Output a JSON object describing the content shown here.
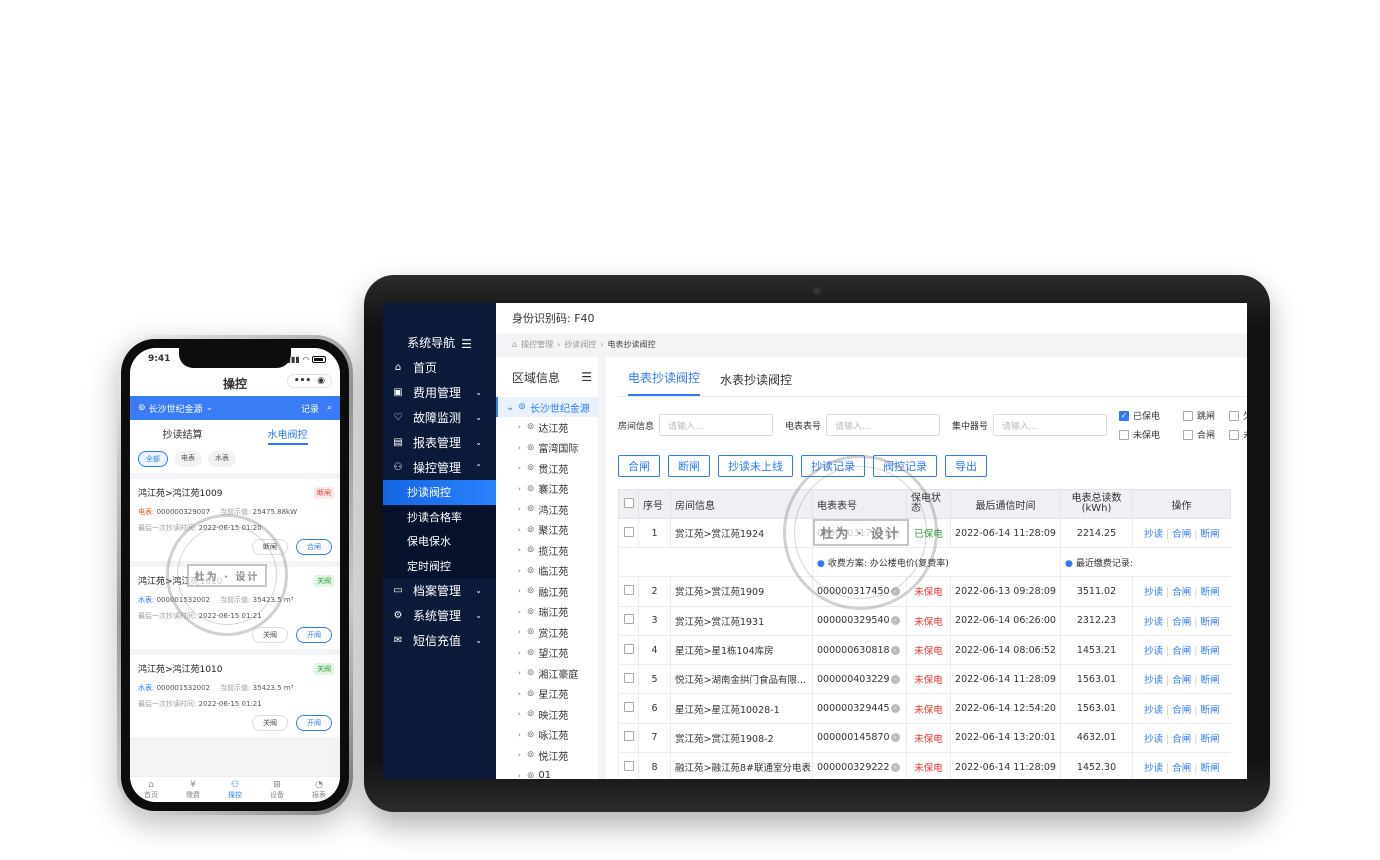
{
  "phone": {
    "time": "9:41",
    "title": "操控",
    "more_icon": "•••",
    "location": "长沙世纪金源",
    "record": "记录",
    "tabs": [
      "抄读结算",
      "水电阀控"
    ],
    "filters": [
      "全部",
      "电表",
      "水表"
    ],
    "cards": [
      {
        "title": "鸿江苑>鸿江苑1009",
        "badge": "断闸",
        "badge_color": "red",
        "type_label": "电表:",
        "type_color": "red",
        "number": "000000329007",
        "reading_label": "当前示值:",
        "reading": "25475.88kW",
        "last_label": "最后一次抄读时间:",
        "last_time": "2022-06-15 01:20",
        "btn1": "断闸",
        "btn2": "合闸"
      },
      {
        "title": "鸿江苑>鸿江苑1010",
        "badge": "关阀",
        "badge_color": "green",
        "type_label": "水表:",
        "type_color": "blue",
        "number": "000001532002",
        "reading_label": "当前示值:",
        "reading": "35423.5 m³",
        "last_label": "最后一次抄读时间:",
        "last_time": "2022-06-15 01:21",
        "btn1": "关阀",
        "btn2": "开阀"
      },
      {
        "title": "鸿江苑>鸿江苑1010",
        "badge": "关阀",
        "badge_color": "green",
        "type_label": "水表:",
        "type_color": "blue",
        "number": "000001532002",
        "reading_label": "当前示值:",
        "reading": "35423.5 m³",
        "last_label": "最后一次抄读时间:",
        "last_time": "2022-06-15 01:21",
        "btn1": "关阀",
        "btn2": "开阀"
      }
    ],
    "tabbar": [
      "首页",
      "缴费",
      "操控",
      "设备",
      "报表"
    ]
  },
  "desktop": {
    "nav_title": "系统导航",
    "menu": [
      {
        "label": "首页",
        "icon": "home-icon"
      },
      {
        "label": "费用管理",
        "icon": "wallet-icon"
      },
      {
        "label": "故障监测",
        "icon": "heart-icon"
      },
      {
        "label": "报表管理",
        "icon": "report-icon"
      },
      {
        "label": "操控管理",
        "icon": "user-control-icon"
      }
    ],
    "submenu": [
      "抄读阀控",
      "抄读合格率",
      "保电保水",
      "定时阀控"
    ],
    "menu_after": [
      {
        "label": "档案管理",
        "icon": "folder-icon"
      },
      {
        "label": "系统管理",
        "icon": "settings-icon"
      },
      {
        "label": "短信充值",
        "icon": "sms-icon"
      }
    ],
    "identity": "身份识别码: F40",
    "breadcrumb": [
      "操控管理",
      "抄读阀控",
      "电表抄读阀控"
    ],
    "tree_title": "区域信息",
    "tree_root": "长沙世纪金源",
    "tree_nodes": [
      "达江苑",
      "富湾国际",
      "贯江苑",
      "褰江苑",
      "鸿江苑",
      "聚江苑",
      "揽江苑",
      "临江苑",
      "融江苑",
      "瑞江苑",
      "赏江苑",
      "望江苑",
      "湘江豪庭",
      "星江苑",
      "映江苑",
      "咏江苑",
      "悦江苑",
      "01"
    ],
    "tabs": [
      "电表抄读阀控",
      "水表抄读阀控"
    ],
    "filters": {
      "room_label": "房间信息",
      "room_placeholder": "请输入...",
      "meter_label": "电表表号",
      "meter_placeholder": "请输入...",
      "hub_label": "集中器号",
      "hub_placeholder": "请输入..."
    },
    "checks": [
      {
        "label": "已保电",
        "checked": true
      },
      {
        "label": "跳闸",
        "checked": false
      },
      {
        "label": "欠费",
        "checked": false
      },
      {
        "label": "未保电",
        "checked": false
      },
      {
        "label": "合闸",
        "checked": false
      },
      {
        "label": "未欠",
        "checked": false
      }
    ],
    "buttons": [
      "合闸",
      "断闸",
      "抄读未上线",
      "抄读记录",
      "阀控记录",
      "导出"
    ],
    "columns": [
      "序号",
      "房间信息",
      "电表表号",
      "保电状态",
      "最后通信时间",
      "电表总读数(kWh)",
      "操作"
    ],
    "sub_row": {
      "plan": "收费方案: 办公楼电价(复费率)",
      "recent": "最近缴费记录:"
    },
    "rows": [
      {
        "no": "1",
        "room": "赏江苑>赏江苑1924",
        "meter": "000000317451",
        "status": "已保电",
        "status_color": "green",
        "time": "2022-06-14 11:28:09",
        "reading": "2214.25"
      },
      {
        "no": "2",
        "room": "赏江苑>赏江苑1909",
        "meter": "000000317450",
        "status": "未保电",
        "status_color": "red",
        "time": "2022-06-13 09:28:09",
        "reading": "3511.02"
      },
      {
        "no": "3",
        "room": "赏江苑>赏江苑1931",
        "meter": "000000329540",
        "status": "未保电",
        "status_color": "red",
        "time": "2022-06-14 06:26:00",
        "reading": "2312.23"
      },
      {
        "no": "4",
        "room": "星江苑>星1栋104库房",
        "meter": "000000630818",
        "status": "未保电",
        "status_color": "red",
        "time": "2022-06-14 08:06:52",
        "reading": "1453.21"
      },
      {
        "no": "5",
        "room": "悦江苑>湖南金拱门食品有限...",
        "meter": "000000403229",
        "status": "未保电",
        "status_color": "red",
        "time": "2022-06-14 11:28:09",
        "reading": "1563.01"
      },
      {
        "no": "6",
        "room": "星江苑>星江苑10028-1",
        "meter": "000000329445",
        "status": "未保电",
        "status_color": "red",
        "time": "2022-06-14 12:54:20",
        "reading": "1563.01"
      },
      {
        "no": "7",
        "room": "赏江苑>赏江苑1908-2",
        "meter": "000000145870",
        "status": "未保电",
        "status_color": "red",
        "time": "2022-06-14 13:20:01",
        "reading": "4632.01"
      },
      {
        "no": "8",
        "room": "融江苑>融江苑8#联通室分电表",
        "meter": "000000329222",
        "status": "未保电",
        "status_color": "red",
        "time": "2022-06-14 11:28:09",
        "reading": "1452.30"
      }
    ],
    "ops": [
      "抄读",
      "合闸",
      "断闸"
    ]
  },
  "watermark": "杜为 · 设计"
}
